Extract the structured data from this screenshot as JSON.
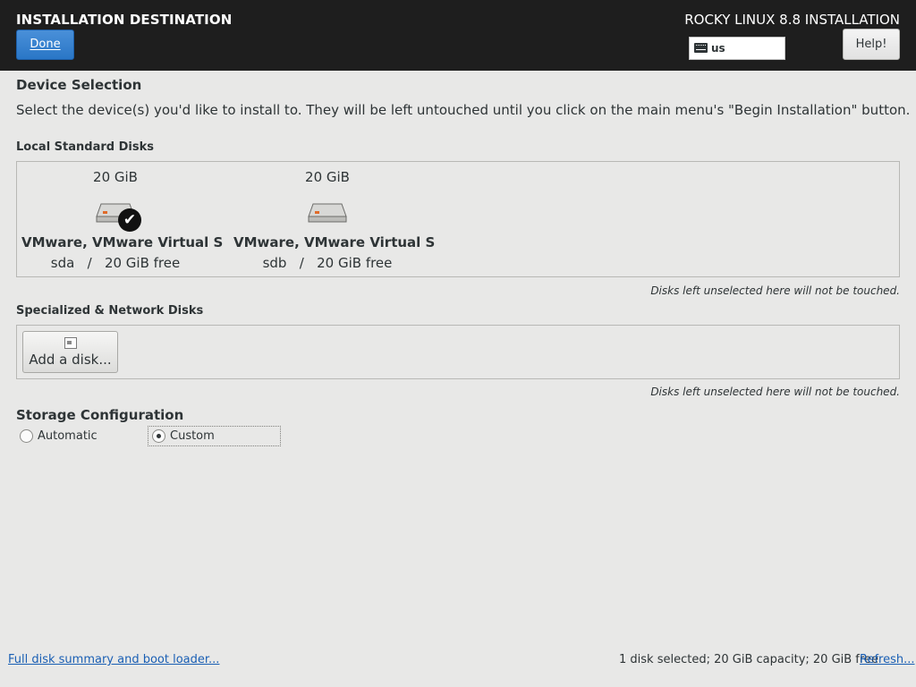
{
  "header": {
    "title": "INSTALLATION DESTINATION",
    "product": "ROCKY LINUX 8.8 INSTALLATION",
    "done_label": "Done",
    "keyboard_layout": "us",
    "help_label": "Help!"
  },
  "device_selection": {
    "heading": "Device Selection",
    "intro": "Select the device(s) you'd like to install to.  They will be left untouched until you click on the main menu's \"Begin Installation\" button."
  },
  "local_disks": {
    "heading": "Local Standard Disks",
    "disks": [
      {
        "capacity": "20 GiB",
        "name": "VMware, VMware Virtual S",
        "info": "sda   /   20 GiB free",
        "selected": true
      },
      {
        "capacity": "20 GiB",
        "name": "VMware, VMware Virtual S",
        "info": "sdb   /   20 GiB free",
        "selected": false
      }
    ],
    "note": "Disks left unselected here will not be touched."
  },
  "specialized_disks": {
    "heading": "Specialized & Network Disks",
    "add_disk_label": "Add a disk...",
    "note": "Disks left unselected here will not be touched."
  },
  "storage_config": {
    "heading": "Storage Configuration",
    "options": [
      {
        "label": "Automatic",
        "selected": false
      },
      {
        "label": "Custom",
        "selected": true
      }
    ]
  },
  "footer": {
    "summary_link": "Full disk summary and boot loader...",
    "status": "1 disk selected; 20 GiB capacity; 20 GiB free",
    "refresh_link": "Refresh..."
  }
}
